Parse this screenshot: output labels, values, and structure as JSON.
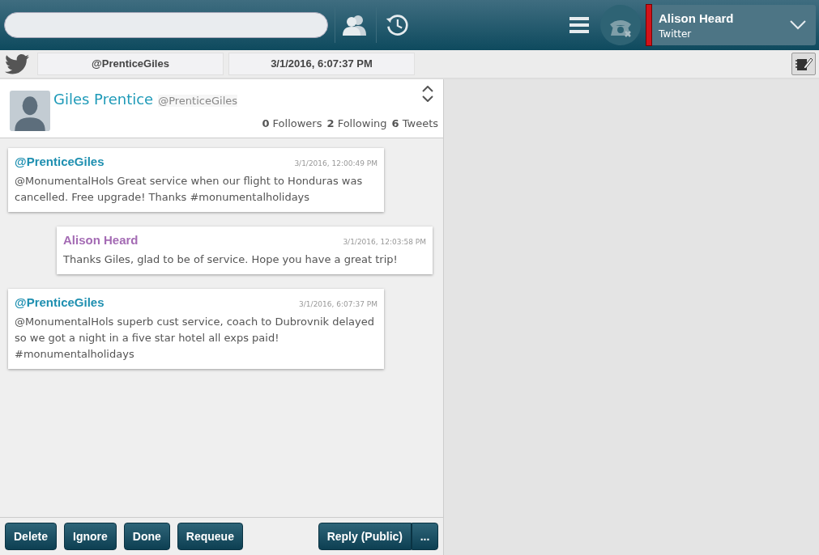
{
  "header": {
    "agent": {
      "name": "Alison Heard",
      "channel": "Twitter"
    }
  },
  "subbar": {
    "handle": "@PrenticeGiles",
    "timestamp": "3/1/2016, 6:07:37 PM"
  },
  "profile": {
    "name": "Giles Prentice",
    "handle": "@PrenticeGiles",
    "stats": [
      {
        "count": "0",
        "label": "Followers"
      },
      {
        "count": "2",
        "label": "Following"
      },
      {
        "count": "6",
        "label": "Tweets"
      }
    ]
  },
  "messages": [
    {
      "kind": "incoming",
      "author": "@PrenticeGiles",
      "time": "3/1/2016, 12:00:49 PM",
      "text": "@MonumentalHols Great service when our flight to Honduras was cancelled. Free upgrade! Thanks #monumentalholidays"
    },
    {
      "kind": "outgoing",
      "author": "Alison Heard",
      "time": "3/1/2016, 12:03:58 PM",
      "text": "Thanks Giles, glad to be of service. Hope you have a great trip!"
    },
    {
      "kind": "incoming",
      "author": "@PrenticeGiles",
      "time": "3/1/2016, 6:07:37 PM",
      "text": "@MonumentalHols superb cust service, coach to Dubrovnik delayed so we got a night in a five star hotel all exps paid! #monumentalholidays"
    }
  ],
  "actions": [
    "Delete",
    "Ignore",
    "Done",
    "Requeue"
  ],
  "reply": {
    "label": "Reply (Public)",
    "more": "..."
  }
}
